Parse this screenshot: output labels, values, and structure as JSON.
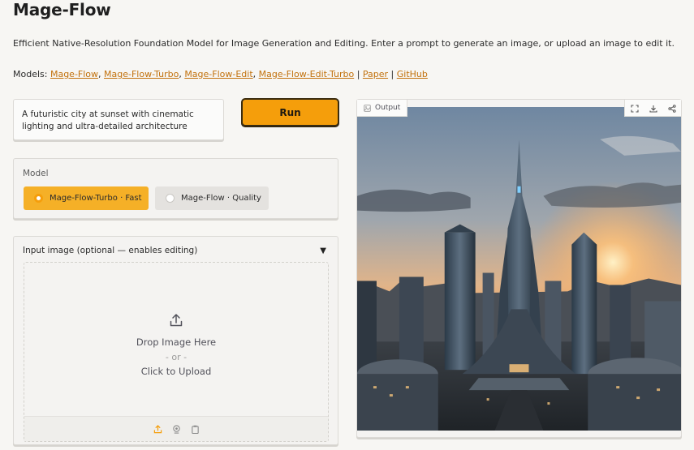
{
  "header": {
    "title": "Mage-Flow",
    "description": "Efficient Native-Resolution Foundation Model for Image Generation and Editing. Enter a prompt to generate an image, or upload an image to edit it.",
    "models_prefix": "Models:",
    "links": [
      {
        "label": "Mage-Flow"
      },
      {
        "label": "Mage-Flow-Turbo"
      },
      {
        "label": "Mage-Flow-Edit"
      },
      {
        "label": "Mage-Flow-Edit-Turbo"
      },
      {
        "label": "Paper"
      },
      {
        "label": "GitHub"
      }
    ]
  },
  "prompt": {
    "value": "A futuristic city at sunset with cinematic lighting and ultra-detailed architecture"
  },
  "run_button": {
    "label": "Run"
  },
  "model_selector": {
    "label": "Model",
    "options": [
      {
        "label": "Mage-Flow-Turbo · Fast",
        "selected": true
      },
      {
        "label": "Mage-Flow · Quality",
        "selected": false
      }
    ]
  },
  "upload": {
    "header": "Input image (optional — enables editing)",
    "caret": "▼",
    "drop_text": "Drop Image Here",
    "or_text": "- or -",
    "click_text": "Click to Upload",
    "footer_icons": [
      "upload-icon",
      "webcam-icon",
      "clipboard-icon"
    ]
  },
  "output": {
    "label": "Output",
    "tools": [
      "fullscreen-icon",
      "download-icon",
      "share-icon"
    ],
    "image_description": "generated image"
  },
  "colors": {
    "accent": "#f59e0b",
    "link": "#c2710c",
    "background": "#f7f6f3"
  }
}
